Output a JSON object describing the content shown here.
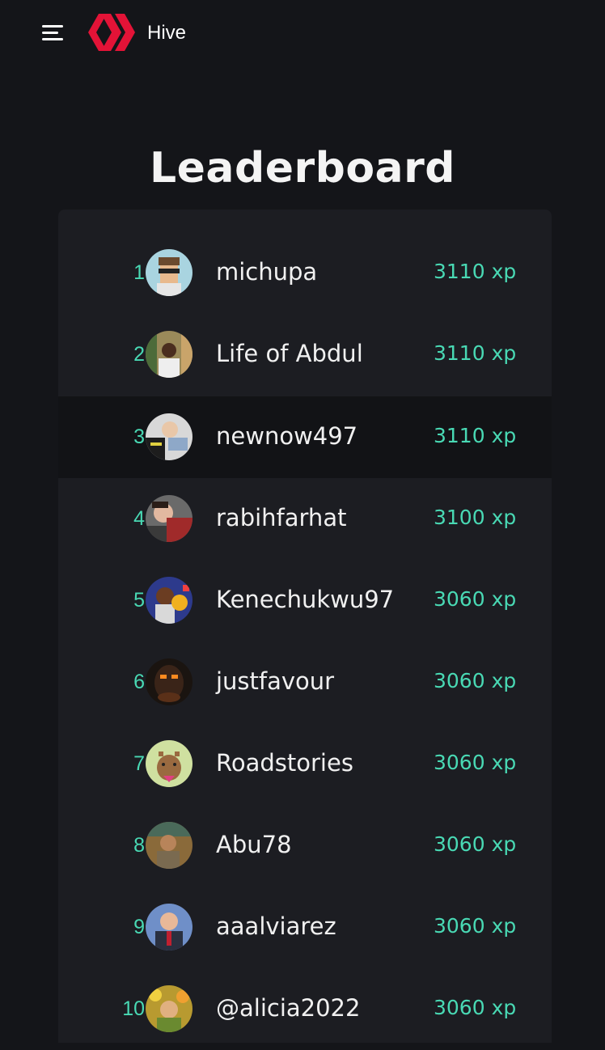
{
  "header": {
    "brand": "Hive",
    "menu_icon": "hamburger-menu-icon",
    "logo_icon": "hive-logo-icon",
    "brand_color": "#e31337"
  },
  "page": {
    "title": "Leaderboard"
  },
  "colors": {
    "accent": "#49d9b4",
    "background": "#141519",
    "card": "#1c1d22",
    "highlight_row": "#121316"
  },
  "leaderboard": [
    {
      "rank": "1",
      "name": "michupa",
      "xp": "3110 xp"
    },
    {
      "rank": "2",
      "name": "Life of Abdul",
      "xp": "3110 xp"
    },
    {
      "rank": "3",
      "name": "newnow497",
      "xp": "3110 xp"
    },
    {
      "rank": "4",
      "name": "rabihfarhat",
      "xp": "3100 xp"
    },
    {
      "rank": "5",
      "name": "Kenechukwu97",
      "xp": "3060 xp"
    },
    {
      "rank": "6",
      "name": "justfavour",
      "xp": "3060 xp"
    },
    {
      "rank": "7",
      "name": "Roadstories",
      "xp": "3060 xp"
    },
    {
      "rank": "8",
      "name": "Abu78",
      "xp": "3060 xp"
    },
    {
      "rank": "9",
      "name": "aaalviarez",
      "xp": "3060 xp"
    },
    {
      "rank": "10",
      "name": "@alicia2022",
      "xp": "3060 xp"
    }
  ]
}
